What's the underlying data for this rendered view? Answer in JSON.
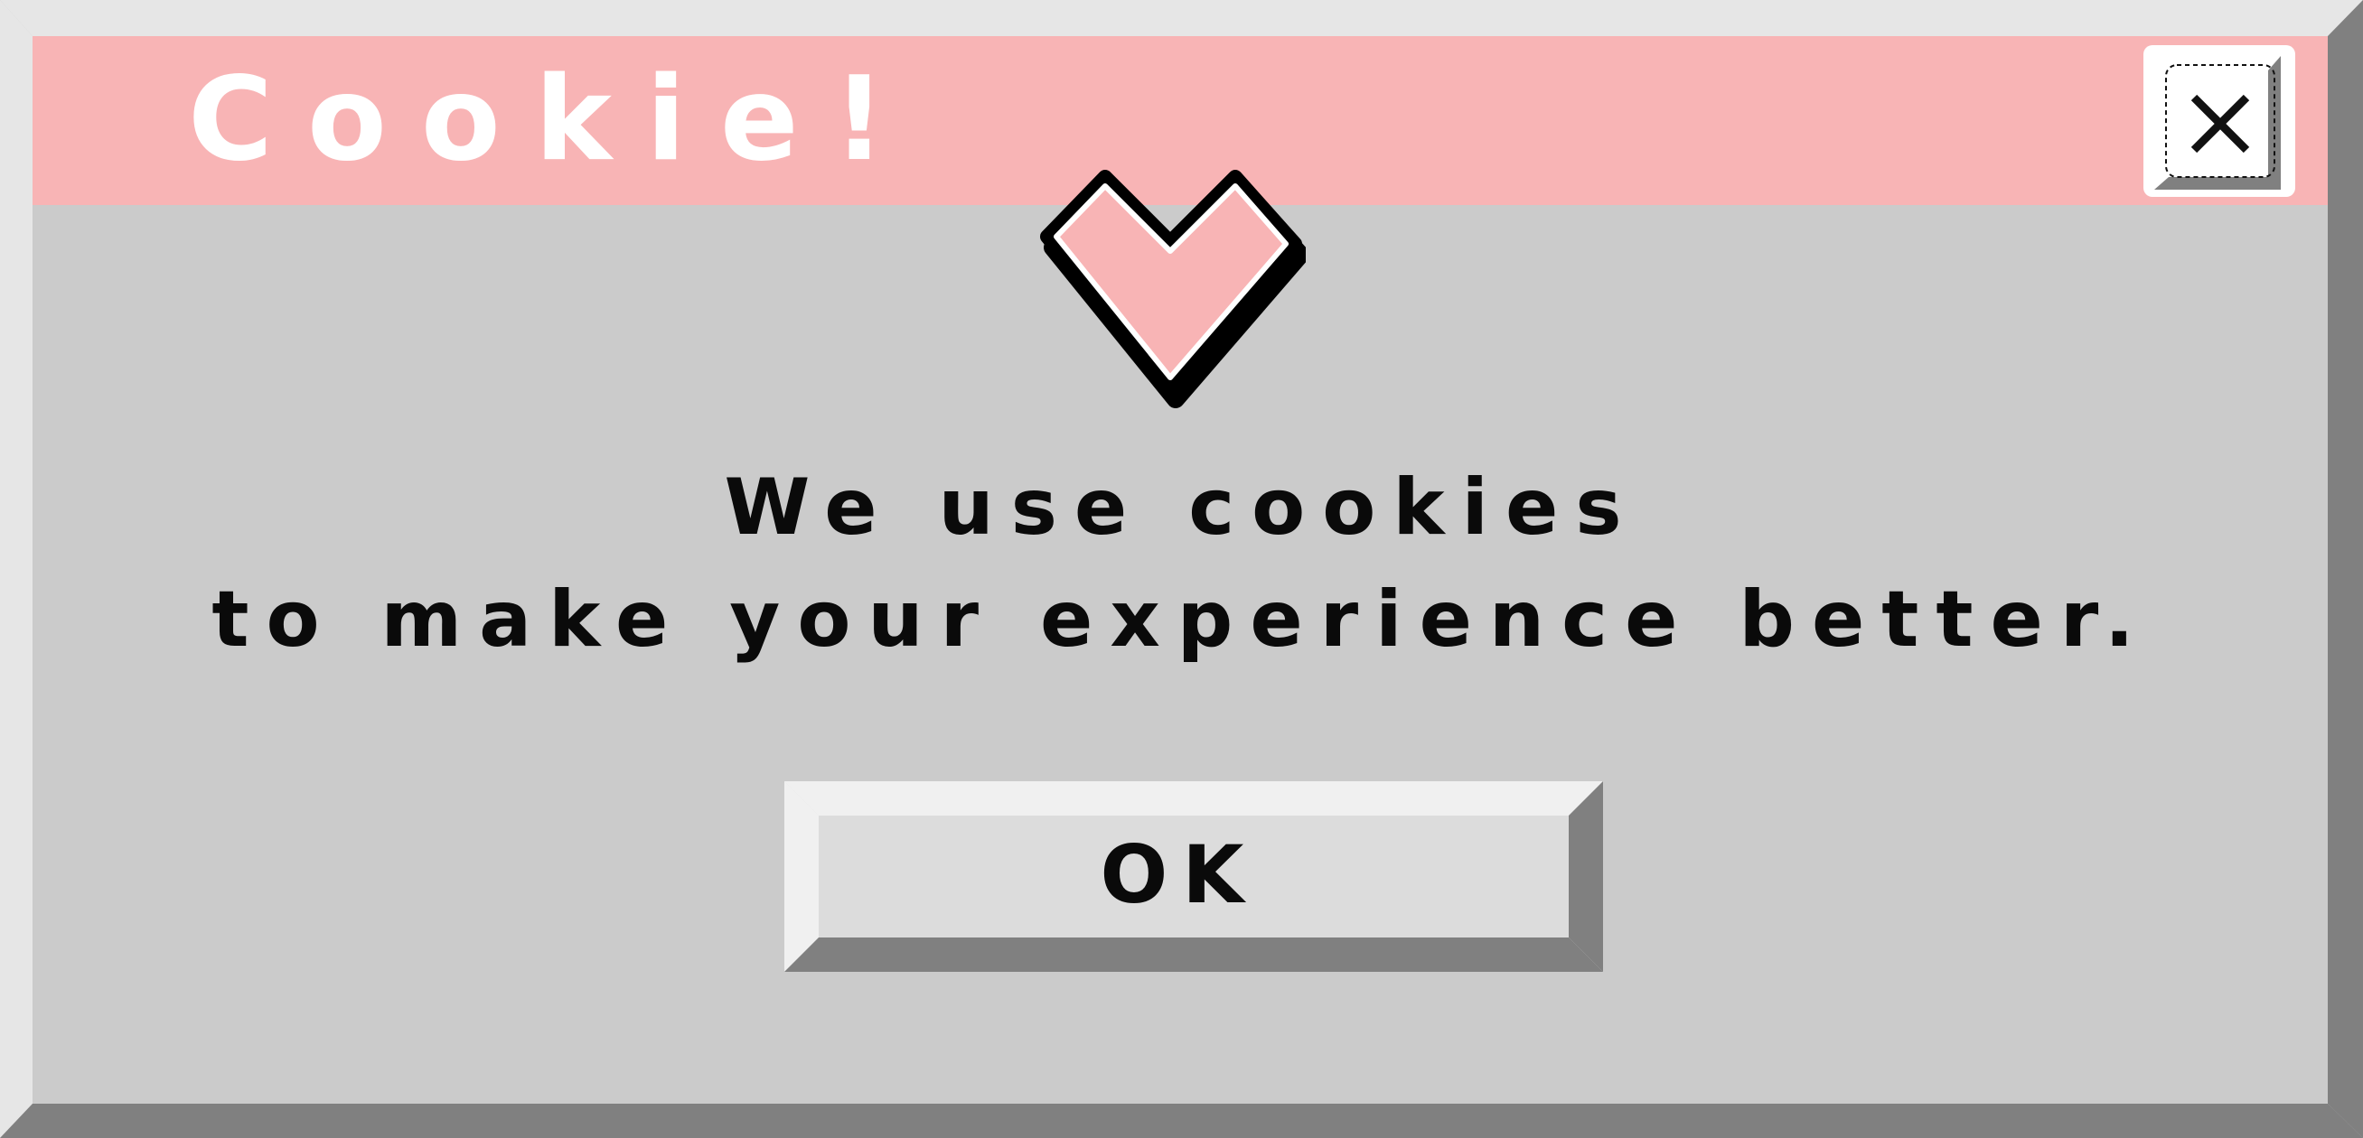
{
  "dialog": {
    "title": "Cookie!",
    "message_line1": "We use cookies",
    "message_line2": "to make your experience better.",
    "ok_label": "OK"
  },
  "icons": {
    "close": "close-icon",
    "heart": "heart-icon"
  },
  "colors": {
    "titlebar": "#f8b4b5",
    "body": "#cbcbcb",
    "heart_fill": "#f8b4b5",
    "bevel_light": "#e6e6e6",
    "bevel_dark": "#808080",
    "button_face": "#dcdcdc",
    "title_text": "#ffffff",
    "message_text": "#0a0a0a"
  }
}
